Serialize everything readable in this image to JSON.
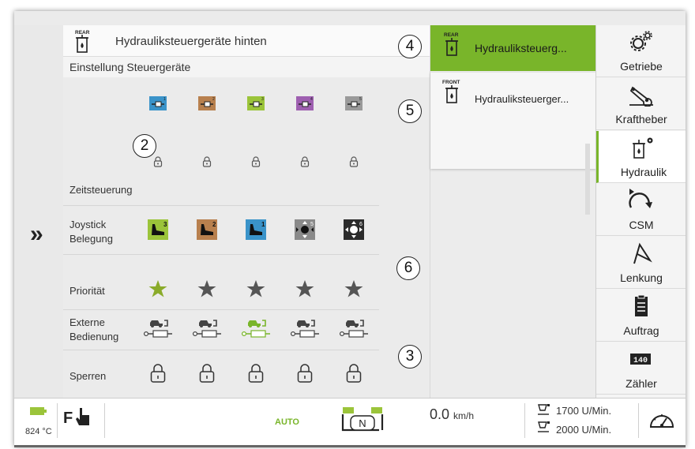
{
  "header": {
    "tag": "REAR",
    "title": "Hydrauliksteuergeräte hinten",
    "subtitle": "Einstellung Steuergeräte"
  },
  "valves": [
    {
      "number": "1",
      "color": "#3a93c9"
    },
    {
      "number": "2",
      "color": "#b8804e"
    },
    {
      "number": "3",
      "color": "#9bc43a"
    },
    {
      "number": "4",
      "color": "#9e5fb0"
    },
    {
      "number": "5",
      "color": "#9a9a9a"
    }
  ],
  "rows": {
    "time_control": "Zeitsteuerung",
    "joystick_label_1": "Joystick",
    "joystick_label_2": "Belegung",
    "priority": "Priorität",
    "external_label_1": "Externe",
    "external_label_2": "Bedienung",
    "locks": "Sperren"
  },
  "joystick_numbers": [
    "3",
    "2",
    "1",
    "5",
    "6"
  ],
  "priority_active_index": 0,
  "external_active_index": 2,
  "callouts": [
    "2",
    "4",
    "5",
    "6",
    "3"
  ],
  "tabs": {
    "rear_tag": "REAR",
    "rear_label": "Hydrauliksteuerg...",
    "front_tag": "FRONT",
    "front_label": "Hydrauliksteuerger..."
  },
  "sidebar": [
    {
      "label": "Getriebe",
      "icon": "gears-icon"
    },
    {
      "label": "Kraftheber",
      "icon": "hitch-icon"
    },
    {
      "label": "Hydraulik",
      "icon": "hydraulic-icon",
      "active": true
    },
    {
      "label": "CSM",
      "icon": "csm-icon"
    },
    {
      "label": "Lenkung",
      "icon": "steering-icon"
    },
    {
      "label": "Auftrag",
      "icon": "clipboard-icon"
    },
    {
      "label": "Zähler",
      "icon": "counter-icon"
    }
  ],
  "status": {
    "temperature": "824 °C",
    "fnr": "F",
    "auto": "AUTO",
    "gear": "N",
    "speed_value": "0.0",
    "speed_unit": "km/h",
    "rpm_1": "1700 U/Min.",
    "rpm_2": "2000 U/Min.",
    "counter_digits": "140"
  },
  "colors": {
    "accent": "#79b52a",
    "star_active": "#8aab2a",
    "star_inactive": "#555555"
  }
}
